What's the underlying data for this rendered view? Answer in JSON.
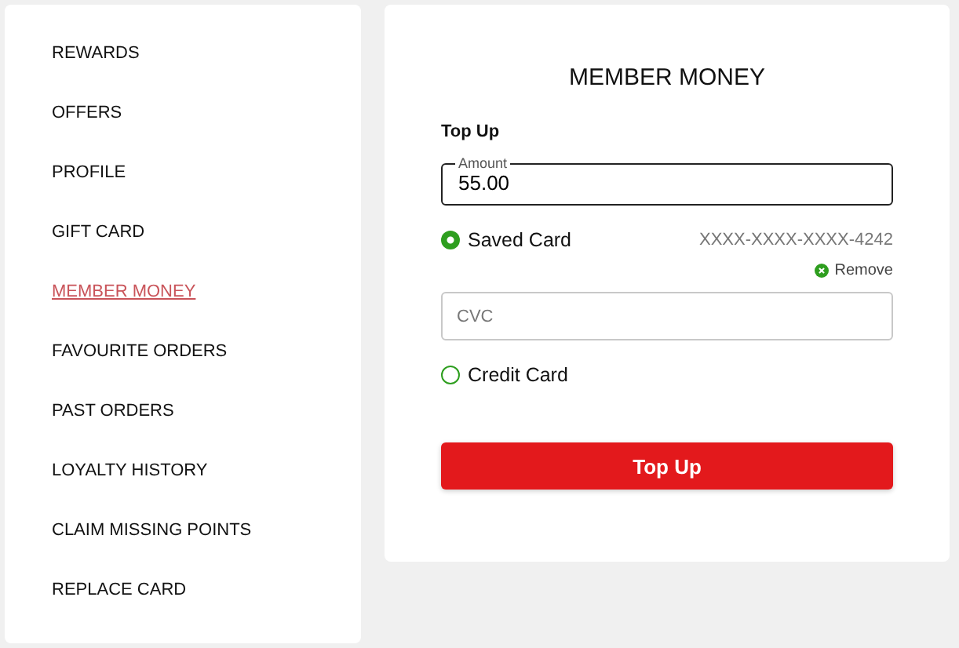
{
  "sidebar": {
    "items": [
      {
        "label": "REWARDS",
        "selected": false
      },
      {
        "label": "OFFERS",
        "selected": false
      },
      {
        "label": "PROFILE",
        "selected": false
      },
      {
        "label": "GIFT CARD",
        "selected": false
      },
      {
        "label": "MEMBER MONEY",
        "selected": true
      },
      {
        "label": "FAVOURITE ORDERS",
        "selected": false
      },
      {
        "label": "PAST ORDERS",
        "selected": false
      },
      {
        "label": "LOYALTY HISTORY",
        "selected": false
      },
      {
        "label": "CLAIM MISSING POINTS",
        "selected": false
      },
      {
        "label": "REPLACE CARD",
        "selected": false
      }
    ]
  },
  "main": {
    "title": "MEMBER MONEY",
    "section": "Top Up",
    "amount": {
      "label": "Amount",
      "value": "55.00"
    },
    "payment_options": [
      {
        "label": "Saved Card",
        "selected": true,
        "card_number": "XXXX-XXXX-XXXX-4242",
        "remove": "Remove",
        "cvc_placeholder": "CVC"
      },
      {
        "label": "Credit Card",
        "selected": false
      }
    ],
    "submit": "Top Up"
  }
}
